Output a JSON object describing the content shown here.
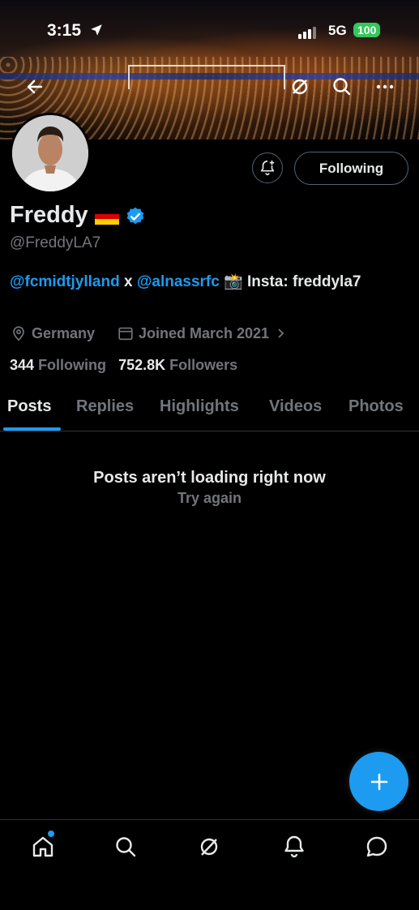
{
  "status_bar": {
    "time": "3:15",
    "network": "5G",
    "battery": "100"
  },
  "profile": {
    "name": "Freddy",
    "handle": "@FreddyLA7",
    "bio": {
      "mention1": "@fcmidtjylland",
      "sep": " x ",
      "mention2": "@alnassrfc",
      "camera": " 📸 ",
      "rest": "Insta: freddyla7"
    },
    "location": "Germany",
    "joined": "Joined March 2021",
    "following_count": "344",
    "following_label": "Following",
    "followers_count": "752.8K",
    "followers_label": "Followers"
  },
  "buttons": {
    "following": "Following"
  },
  "tabs": [
    "Posts",
    "Replies",
    "Highlights",
    "Videos",
    "Photos"
  ],
  "active_tab": "Posts",
  "error": {
    "title": "Posts aren’t loading right now",
    "retry": "Try again"
  },
  "icons": {
    "back": "arrow-left-icon",
    "grok": "grok-icon",
    "search": "search-icon",
    "more": "more-icon",
    "notify": "bell-plus-icon",
    "verified": "verified-badge-icon",
    "location": "location-pin-icon",
    "calendar": "calendar-icon",
    "compose": "plus-icon",
    "nav": [
      "home-icon",
      "search-icon",
      "grok-icon",
      "bell-icon",
      "messages-icon"
    ]
  },
  "colors": {
    "accent": "#1d9bf0",
    "muted": "#71767b",
    "battery": "#34c759"
  }
}
